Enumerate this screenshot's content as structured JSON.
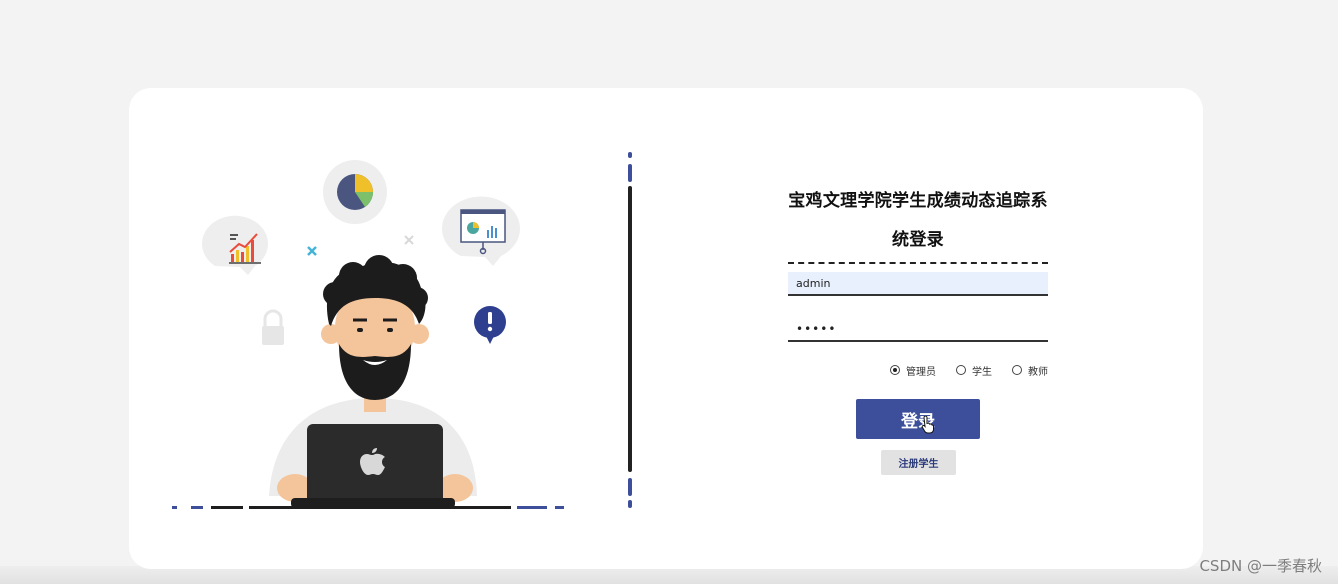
{
  "login": {
    "title": "宝鸡文理学院学生成绩动态追踪系统登录",
    "username_value": "admin",
    "password_value": "•••••",
    "roles": [
      {
        "label": "管理员",
        "checked": true
      },
      {
        "label": "学生",
        "checked": false
      },
      {
        "label": "教师",
        "checked": false
      }
    ],
    "login_button_label": "登录",
    "register_button_label": "注册学生"
  },
  "illustration": {
    "description_icons": [
      "pie-chart-icon",
      "bar-chart-icon",
      "presentation-icon",
      "lock-icon",
      "alert-icon",
      "laptop-icon",
      "apple-logo-icon"
    ]
  },
  "watermark": "CSDN @一季春秋",
  "colors": {
    "primary": "#3d4f9b",
    "background": "#f4f3f3",
    "card": "#ffffff",
    "username_fill": "#e8f0fe"
  }
}
